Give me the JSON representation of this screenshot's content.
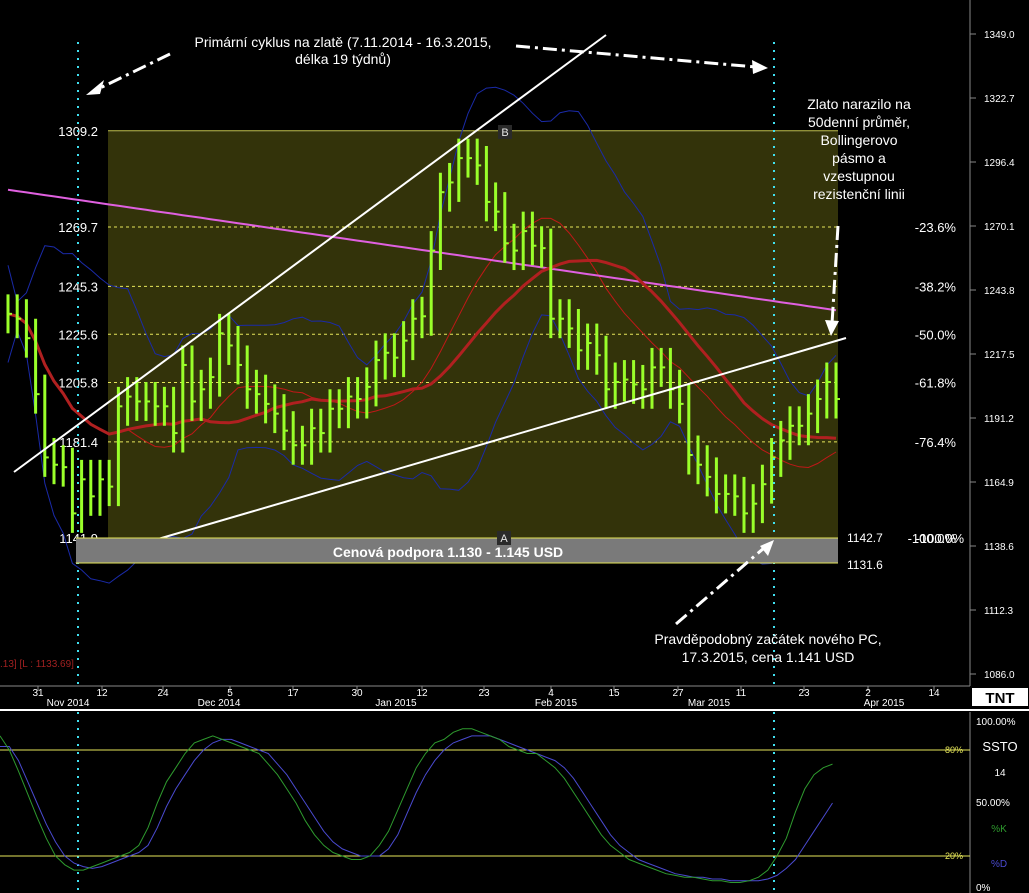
{
  "colors": {
    "background": "#000000",
    "price_bar": "#9aff2a",
    "fib_zone": "#33330a",
    "fib_line": "#e6e65a",
    "ma50": "#b02020",
    "ma200": "#e060e0",
    "bb_mid": "#c01818",
    "bb_band": "#1a2aa8",
    "cycle_line": "#40e0f0",
    "support_band": "#7a7a7a",
    "annotation": "#ffffff",
    "stoch_k": "#2e9a2e",
    "stoch_d": "#4a4ad0"
  },
  "chart_data": [
    {
      "type": "line",
      "panel": "price",
      "y_axis_ticks": [
        "1349.0",
        "1322.7",
        "1296.4",
        "1270.1",
        "1243.8",
        "1217.5",
        "1191.2",
        "1164.9",
        "1138.6",
        "1112.3",
        "1086.0"
      ],
      "ylim": [
        1086.0,
        1349.0
      ],
      "x_axis_day_labels": [
        "31",
        "12",
        "24",
        "5",
        "17",
        "30",
        "12",
        "23",
        "4",
        "15",
        "27",
        "11",
        "23",
        "2",
        "14"
      ],
      "x_axis_month_labels": [
        "Nov 2014",
        "Dec 2014",
        "Jan 2015",
        "Feb 2015",
        "Mar 2015",
        "Apr 2015"
      ],
      "price_bars_close": [
        1234,
        1232,
        1224,
        1201,
        1175,
        1172,
        1171,
        1152,
        1166,
        1159,
        1166,
        1163,
        1196,
        1200,
        1198,
        1198,
        1196,
        1196,
        1185,
        1213,
        1198,
        1203,
        1208,
        1226,
        1221,
        1213,
        1203,
        1201,
        1197,
        1193,
        1186,
        1180,
        1180,
        1187,
        1185,
        1195,
        1195,
        1200,
        1199,
        1204,
        1215,
        1218,
        1216,
        1223,
        1232,
        1233,
        1260,
        1284,
        1288,
        1298,
        1298,
        1295,
        1280,
        1276,
        1263,
        1260,
        1268,
        1262,
        1261,
        1232,
        1232,
        1228,
        1219,
        1222,
        1217,
        1203,
        1206,
        1207,
        1205,
        1203,
        1212,
        1212,
        1203,
        1197,
        1176,
        1172,
        1167,
        1160,
        1160,
        1159,
        1152,
        1156,
        1164,
        1175,
        1182,
        1188,
        1188,
        1193,
        1199,
        1206,
        1199
      ],
      "fib_levels": [
        {
          "price": "1309.2",
          "pct": ""
        },
        {
          "price": "1269.7",
          "pct": "-23.6%"
        },
        {
          "price": "1245.3",
          "pct": "-38.2%"
        },
        {
          "price": "1225.6",
          "pct": "-50.0%"
        },
        {
          "price": "1205.8",
          "pct": "-61.8%"
        },
        {
          "price": "1181.4",
          "pct": "-76.4%"
        },
        {
          "price": "1141.9",
          "pct": "-100.0%"
        }
      ],
      "fib_point_labels": {
        "a": "A",
        "b": "B"
      },
      "support_band_label": "Cenová podpora 1.130 - 1.145 USD",
      "support_prices": {
        "upper": "1142.7",
        "lower": "1131.6"
      },
      "legend_fragment": ".13] [L : 1133.69]"
    },
    {
      "type": "line",
      "panel": "stochastic",
      "title": "SSTO",
      "period": "14",
      "series_labels": [
        "%K",
        "%D"
      ],
      "y_ticks": [
        "100.00%",
        "50.00%",
        "0%"
      ],
      "level_labels": [
        "80%",
        "20%"
      ],
      "ylim": [
        0,
        100
      ],
      "k": [
        88,
        80,
        68,
        55,
        42,
        30,
        20,
        15,
        12,
        12,
        14,
        16,
        18,
        20,
        22,
        26,
        36,
        50,
        62,
        70,
        78,
        84,
        86,
        88,
        86,
        84,
        82,
        80,
        78,
        72,
        66,
        58,
        50,
        40,
        32,
        26,
        22,
        20,
        18,
        18,
        20,
        26,
        34,
        46,
        58,
        70,
        78,
        84,
        86,
        90,
        92,
        92,
        90,
        88,
        86,
        82,
        80,
        78,
        78,
        74,
        70,
        64,
        56,
        48,
        40,
        32,
        26,
        22,
        18,
        16,
        14,
        12,
        10,
        9,
        8,
        8,
        7,
        6,
        6,
        5,
        5,
        6,
        8,
        12,
        20,
        30,
        45,
        58,
        66,
        70,
        72
      ],
      "d": [
        82,
        82,
        74,
        62,
        50,
        38,
        28,
        20,
        16,
        14,
        13,
        14,
        16,
        18,
        20,
        22,
        26,
        36,
        48,
        58,
        66,
        74,
        80,
        84,
        86,
        86,
        84,
        82,
        80,
        78,
        72,
        66,
        58,
        50,
        42,
        34,
        28,
        24,
        22,
        20,
        20,
        20,
        24,
        32,
        44,
        56,
        66,
        74,
        80,
        84,
        86,
        88,
        88,
        88,
        86,
        84,
        82,
        80,
        78,
        76,
        74,
        70,
        64,
        56,
        48,
        40,
        32,
        26,
        22,
        18,
        16,
        14,
        12,
        10,
        9,
        8,
        8,
        7,
        7,
        6,
        6,
        6,
        6,
        7,
        9,
        13,
        18,
        26,
        34,
        42,
        50
      ]
    }
  ],
  "annotations": {
    "cycle": [
      "Primární cyklus na zlatě (7.11.2014 - 16.3.2015,",
      "délka 19 týdnů)"
    ],
    "resistance": [
      "Zlato narazilo na",
      "50denní průměr,",
      "Bollingerovo",
      "pásmo a",
      "vzestupnou",
      "rezistenční linii"
    ],
    "new_cycle": [
      "Pravděpodobný začátek nového PC,",
      "17.3.2015, cena 1.141 USD"
    ]
  },
  "logo": "TNT"
}
